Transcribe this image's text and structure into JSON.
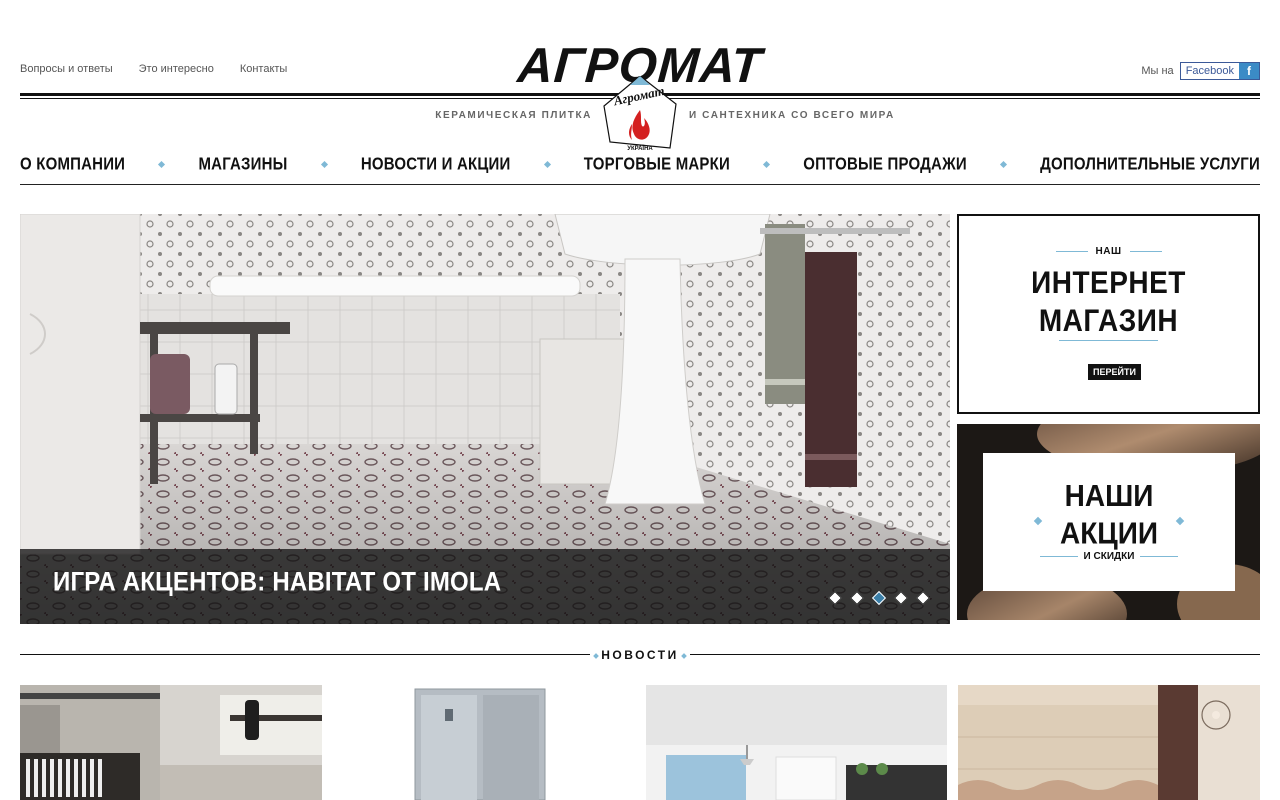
{
  "header": {
    "top_links": [
      "Вопросы и ответы",
      "Это интересно",
      "Контакты"
    ],
    "logo_text": "АГРОМАТ",
    "emblem_text": "Агромат",
    "emblem_subtext": "УКРАЇНА",
    "tagline_left": "КЕРАМИЧЕСКАЯ ПЛИТКА",
    "tagline_right": "И САНТЕХНИКА СО ВСЕГО МИРА",
    "social_label": "Мы на",
    "facebook_label": "Facebook",
    "facebook_icon": "f"
  },
  "nav": {
    "items": [
      "О КОМПАНИИ",
      "МАГАЗИНЫ",
      "НОВОСТИ И АКЦИИ",
      "ТОРГОВЫЕ МАРКИ",
      "ОПТОВЫЕ ПРОДАЖИ",
      "ДОПОЛНИТЕЛЬНЫЕ УСЛУГИ"
    ]
  },
  "hero": {
    "caption": "ИГРА АКЦЕНТОВ: HABITAT ОТ IMOLA",
    "slide_count": 5,
    "active_slide": 3
  },
  "promo_shop": {
    "small": "НАШ",
    "big_line1": "ИНТЕРНЕТ",
    "big_line2": "МАГАЗИН",
    "button": "ПЕРЕЙТИ"
  },
  "promo_sale": {
    "big_line1": "НАШИ",
    "big_line2": "АКЦИИ",
    "small": "И СКИДКИ"
  },
  "news": {
    "title": "НОВОСТИ"
  },
  "colors": {
    "accent": "#7fb9d6",
    "facebook": "#3b5998",
    "dark": "#111111"
  }
}
